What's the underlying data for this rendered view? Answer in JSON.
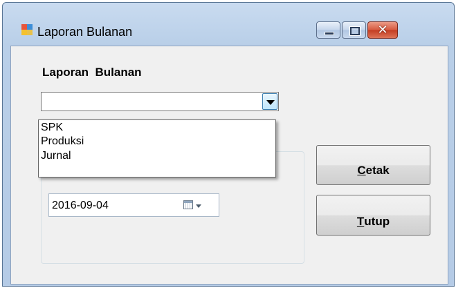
{
  "window": {
    "title": "Laporan Bulanan",
    "icon": "app-window-icon"
  },
  "form": {
    "heading": "Laporan  Bulanan",
    "combo": {
      "value": "",
      "expanded": true,
      "options": [
        "SPK",
        "Produksi",
        "Jurnal"
      ]
    },
    "date": {
      "value": "2016-09-04",
      "icon": "calendar-icon"
    },
    "buttons": {
      "cetak": {
        "mnemonic": "C",
        "rest": "etak"
      },
      "tutup": {
        "mnemonic": "T",
        "rest": "utup"
      }
    }
  },
  "colors": {
    "title_bar": "#b9cfe8",
    "client_bg": "#f0f0f0",
    "close_button": "#c33c21"
  }
}
